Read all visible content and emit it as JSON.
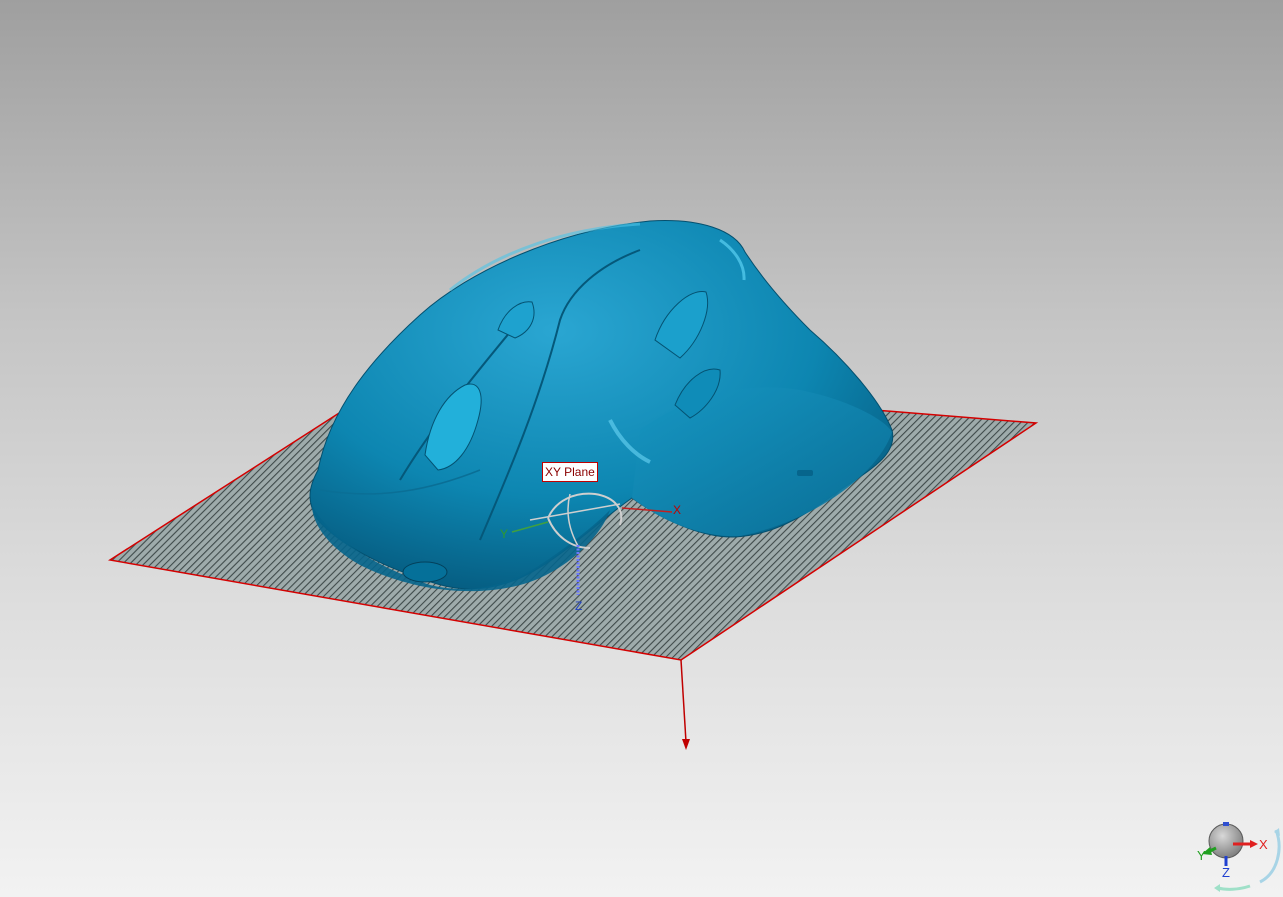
{
  "viewport": {
    "plane_label": "XY Plane",
    "mini_axes": {
      "x": "X",
      "y": "Y",
      "z": "Z"
    }
  },
  "gizmo_axes": {
    "x": "X",
    "y": "Y",
    "z": "Z"
  },
  "view_triad": {
    "x": "X",
    "y": "Y",
    "z": "Z"
  },
  "colors": {
    "model": "#0f8fb8",
    "plane_edge": "#d40000",
    "arrow": "#c00000",
    "triad_x": "#e02020",
    "triad_y": "#20a020",
    "triad_z": "#2040d0"
  },
  "icons": [
    "rotation-gizmo-icon",
    "view-orientation-triad-icon",
    "normal-arrow-icon"
  ]
}
